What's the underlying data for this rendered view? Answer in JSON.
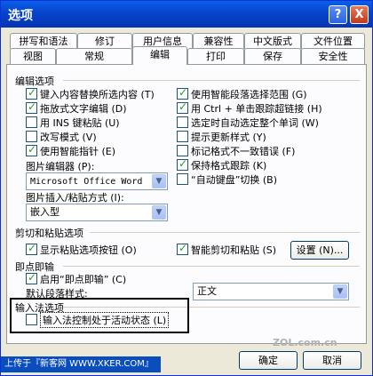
{
  "window": {
    "title": "选项",
    "help_btn": "?",
    "close_btn": "X"
  },
  "tabs_row1": [
    "拼写和语法",
    "修订",
    "用户信息",
    "兼容性",
    "中文版式",
    "文件位置"
  ],
  "tabs_row2": [
    "视图",
    "常规",
    "编辑",
    "打印",
    "保存",
    "安全性"
  ],
  "active_tab": "编辑",
  "edit_options": {
    "heading": "编辑选项",
    "left": [
      {
        "label": "键入内容替换所选内容 (T)",
        "checked": true
      },
      {
        "label": "拖放式文字编辑 (D)",
        "checked": true
      },
      {
        "label": "用 INS 键粘贴 (U)",
        "checked": false
      },
      {
        "label": "改写模式 (V)",
        "checked": false
      },
      {
        "label": "使用智能指针 (E)",
        "checked": true
      }
    ],
    "right": [
      {
        "label": "使用智能段落选择范围 (G)",
        "checked": true
      },
      {
        "label": "用 Ctrl + 单击跟踪超链接 (H)",
        "checked": true
      },
      {
        "label": "选定时自动选定整个单词 (W)",
        "checked": false
      },
      {
        "label": "提示更新样式 (Y)",
        "checked": false
      },
      {
        "label": "标记格式不一致错误 (F)",
        "checked": false
      },
      {
        "label": "保持格式跟踪 (K)",
        "checked": true
      },
      {
        "label": "“自动键盘”切换 (B)",
        "checked": false
      }
    ],
    "picture_editor_label": "图片编辑器 (P):",
    "picture_editor_value": "Microsoft Office Word",
    "insert_paste_label": "图片插入/粘贴方式 (I):",
    "insert_paste_value": "嵌入型"
  },
  "cut_paste": {
    "heading": "剪切和粘贴选项",
    "show_paste_btn": {
      "label": "显示粘贴选项按钮 (O)",
      "checked": true
    },
    "smart_cut": {
      "label": "智能剪切和粘贴 (S)",
      "checked": true
    },
    "settings_btn": "设置 (N)..."
  },
  "click_type": {
    "heading": "即点即输",
    "enable": {
      "label": "启用“即点即输” (C)",
      "checked": true
    },
    "default_style_label": "默认段落样式:",
    "default_style_value": "正文"
  },
  "ime": {
    "heading": "输入法选项",
    "ime_control": {
      "label": "输入法控制处于活动状态 (L)",
      "checked": false
    }
  },
  "footer": {
    "ok": "确定",
    "cancel": "取消"
  },
  "watermark": {
    "left_text": "上传于『新客网 WWW.XKER.COM』",
    "right_text": "ZOL.com.cn"
  }
}
